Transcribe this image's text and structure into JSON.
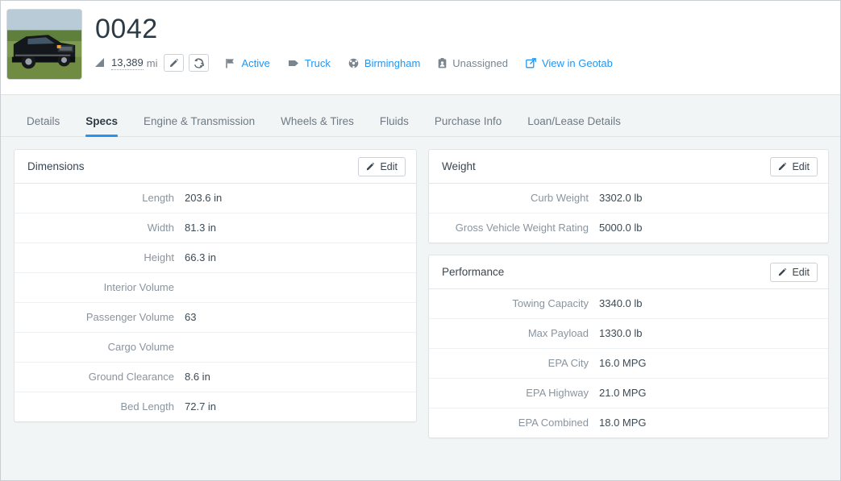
{
  "header": {
    "thumbnail_alt": "black pickup truck parked in field",
    "title": "0042",
    "odometer": {
      "value": "13,389",
      "unit": "mi"
    },
    "edit_odometer_label": "",
    "sync_odometer_label": "",
    "meta": [
      {
        "icon": "flag-icon",
        "label": "Active",
        "link": true
      },
      {
        "icon": "tag-icon",
        "label": "Truck",
        "link": true
      },
      {
        "icon": "steering-wheel-icon",
        "label": "Birmingham",
        "link": true
      },
      {
        "icon": "clipboard-user-icon",
        "label": "Unassigned",
        "link": false
      },
      {
        "icon": "external-link-icon",
        "label": "View in Geotab",
        "link": true
      }
    ]
  },
  "tabs": [
    {
      "label": "Details",
      "active": false
    },
    {
      "label": "Specs",
      "active": true
    },
    {
      "label": "Engine & Transmission",
      "active": false
    },
    {
      "label": "Wheels & Tires",
      "active": false
    },
    {
      "label": "Fluids",
      "active": false
    },
    {
      "label": "Purchase Info",
      "active": false
    },
    {
      "label": "Loan/Lease Details",
      "active": false
    }
  ],
  "edit_label": "Edit",
  "panels": {
    "dimensions": {
      "title": "Dimensions",
      "rows": [
        {
          "label": "Length",
          "value": "203.6 in"
        },
        {
          "label": "Width",
          "value": "81.3 in"
        },
        {
          "label": "Height",
          "value": "66.3 in"
        },
        {
          "label": "Interior Volume",
          "value": ""
        },
        {
          "label": "Passenger Volume",
          "value": "63"
        },
        {
          "label": "Cargo Volume",
          "value": ""
        },
        {
          "label": "Ground Clearance",
          "value": "8.6 in"
        },
        {
          "label": "Bed Length",
          "value": "72.7 in"
        }
      ]
    },
    "weight": {
      "title": "Weight",
      "rows": [
        {
          "label": "Curb Weight",
          "value": "3302.0 lb"
        },
        {
          "label": "Gross Vehicle Weight Rating",
          "value": "5000.0 lb"
        }
      ]
    },
    "performance": {
      "title": "Performance",
      "rows": [
        {
          "label": "Towing Capacity",
          "value": "3340.0 lb"
        },
        {
          "label": "Max Payload",
          "value": "1330.0 lb"
        },
        {
          "label": "EPA City",
          "value": "16.0 MPG"
        },
        {
          "label": "EPA Highway",
          "value": "21.0 MPG"
        },
        {
          "label": "EPA Combined",
          "value": "18.0 MPG"
        }
      ]
    }
  },
  "colors": {
    "link": "#2196f3",
    "accent": "#2196f3",
    "label": "#8a949e",
    "value": "#3c4a54",
    "page_bg": "#f2f5f6"
  }
}
